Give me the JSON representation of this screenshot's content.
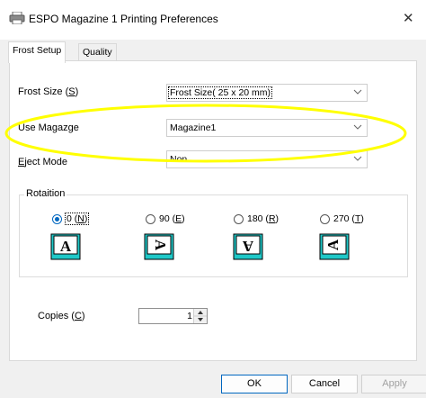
{
  "window": {
    "title": "ESPO Magazine 1 Printing Preferences",
    "close_icon": "close-icon"
  },
  "tabs": [
    {
      "label": "Frost Setup",
      "active": true
    },
    {
      "label": "Quality",
      "active": false
    }
  ],
  "frost_size": {
    "label_prefix": "Frost Size (",
    "label_key": "S",
    "label_suffix": ")",
    "value": "Frost Size( 25 x 20 mm)"
  },
  "use_magazine": {
    "label": "Use Magazge",
    "value": "Magazine1"
  },
  "eject_mode": {
    "label_key": "E",
    "label_rest": "ject Mode",
    "value": "Non"
  },
  "rotation": {
    "label": "Rotaition",
    "options": [
      {
        "num": "0 (",
        "key": "N",
        "end": ")",
        "selected": true
      },
      {
        "num": "90 (",
        "key": "E",
        "end": ")",
        "selected": false
      },
      {
        "num": "180 (",
        "key": "R",
        "end": ")",
        "selected": false
      },
      {
        "num": "270 (",
        "key": "T",
        "end": ")",
        "selected": false
      }
    ]
  },
  "copies": {
    "label_prefix": "Copies (",
    "label_key": "C",
    "label_suffix": ")",
    "value": "1"
  },
  "buttons": {
    "ok": "OK",
    "cancel": "Cancel",
    "apply": "Apply"
  },
  "colors": {
    "accent": "#0067c0",
    "highlight": "#ffff00",
    "icon_teal": "#1fc8c8"
  }
}
